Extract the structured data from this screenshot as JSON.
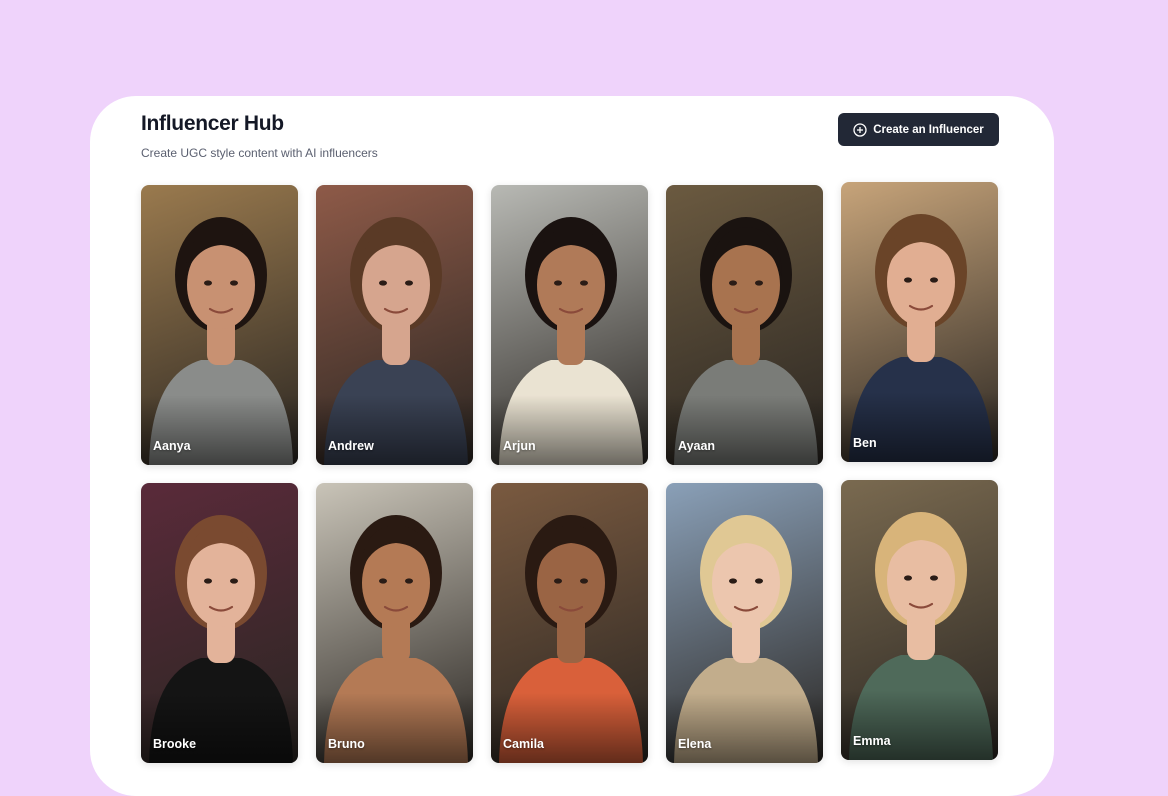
{
  "header": {
    "title": "Influencer Hub",
    "subtitle": "Create UGC style content with AI influencers",
    "create_label": "Create an Influencer",
    "create_icon": "plus-circle-icon"
  },
  "influencers": [
    {
      "name": "Aanya",
      "bg": "#9a7a4e",
      "skin": "#c89172",
      "hair": "#1e1410",
      "shirt": "#8a8c8a"
    },
    {
      "name": "Andrew",
      "bg": "#8e5a48",
      "skin": "#d6a58e",
      "hair": "#5a3a26",
      "shirt": "#3a4254"
    },
    {
      "name": "Arjun",
      "bg": "#b8b9b4",
      "skin": "#b07a58",
      "hair": "#1a1210",
      "shirt": "#eae3d2"
    },
    {
      "name": "Ayaan",
      "bg": "#6b5a40",
      "skin": "#a8734f",
      "hair": "#1a1310",
      "shirt": "#7a7c78"
    },
    {
      "name": "Ben",
      "bg": "#c7a47a",
      "skin": "#e1ae92",
      "hair": "#6a4428",
      "shirt": "#26314a"
    },
    {
      "name": "Brooke",
      "bg": "#5a2a3a",
      "skin": "#e3b39a",
      "hair": "#7a4a30",
      "shirt": "#141414"
    },
    {
      "name": "Bruno",
      "bg": "#c9c4b8",
      "skin": "#b47a55",
      "hair": "#2a1a12",
      "shirt": "#b47a55"
    },
    {
      "name": "Camila",
      "bg": "#7a5a40",
      "skin": "#9a6444",
      "hair": "#2a1a12",
      "shirt": "#d9603a"
    },
    {
      "name": "Elena",
      "bg": "#8aa0b8",
      "skin": "#ecc6ae",
      "hair": "#e0c894",
      "shirt": "#c2ad8c"
    },
    {
      "name": "Emma",
      "bg": "#7a6a50",
      "skin": "#e8bda2",
      "hair": "#d8b47a",
      "shirt": "#4f6a5a"
    }
  ]
}
